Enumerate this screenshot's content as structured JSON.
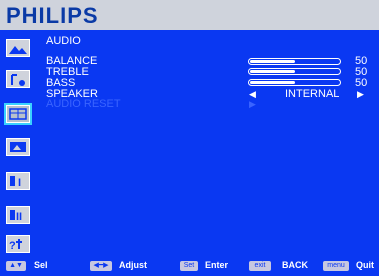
{
  "brand": "PHILIPS",
  "menu": {
    "title": "AUDIO",
    "items": [
      {
        "label": "BALANCE",
        "value": "50",
        "level": 0.5
      },
      {
        "label": "TREBLE",
        "value": "50",
        "level": 0.5
      },
      {
        "label": "BASS",
        "value": "50",
        "level": 0.5
      },
      {
        "label": "SPEAKER",
        "value": "INTERNAL"
      },
      {
        "label": "AUDIO RESET"
      }
    ]
  },
  "sidebar": {
    "icons": [
      "picture-icon",
      "audio-icon",
      "screen-icon",
      "display-icon",
      "configuration-1-icon",
      "configuration-2-icon",
      "advanced-option-icon"
    ],
    "selected": "audio-icon"
  },
  "footer": {
    "sel_label": "Sel",
    "adjust_label": "Adjust",
    "set_key": "Set",
    "enter_label": "Enter",
    "exit_key": "exit",
    "back_label": "BACK",
    "menu_key": "menu",
    "quit_label": "Quit"
  },
  "colors": {
    "background": "#0a38f2",
    "highlight": "#3a64ff",
    "brand": "#0a3aa6"
  }
}
